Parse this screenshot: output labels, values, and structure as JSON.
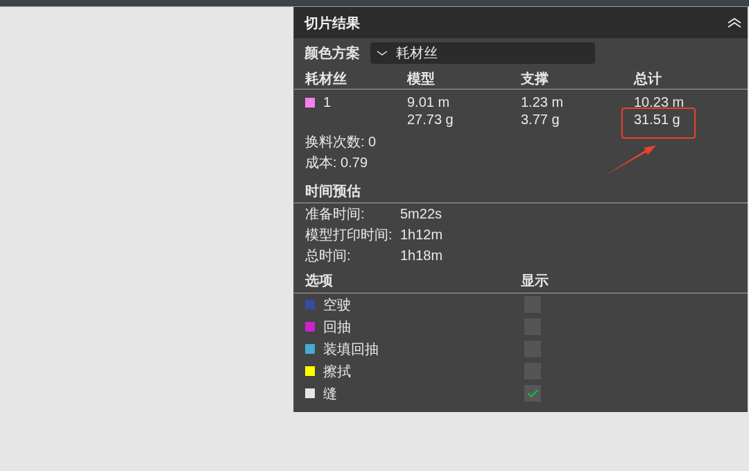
{
  "panel": {
    "title": "切片结果"
  },
  "color_scheme": {
    "label": "颜色方案",
    "value": "耗材丝"
  },
  "filament_table": {
    "columns": [
      "耗材丝",
      "模型",
      "支撑",
      "总计"
    ],
    "rows": [
      {
        "color": "#f77ff2",
        "filament": "1",
        "model": [
          "9.01 m",
          "27.73 g"
        ],
        "support": [
          "1.23 m",
          "3.77 g"
        ],
        "total": [
          "10.23 m",
          "31.51 g"
        ]
      }
    ]
  },
  "summary": [
    "换料次数: 0",
    "成本: 0.79"
  ],
  "time_estimate": {
    "title": "时间预估",
    "items": [
      {
        "label": "准备时间:",
        "value": "5m22s"
      },
      {
        "label": "模型打印时间:",
        "value": "1h12m"
      },
      {
        "label": "总时间:",
        "value": "1h18m"
      }
    ]
  },
  "options": {
    "columns": [
      "选项",
      "显示"
    ],
    "items": [
      {
        "label": "空驶",
        "color": "#3a4a9c",
        "checked": false
      },
      {
        "label": "回抽",
        "color": "#cc22cc",
        "checked": false
      },
      {
        "label": "装填回抽",
        "color": "#47acd0",
        "checked": false
      },
      {
        "label": "擦拭",
        "color": "#ffff00",
        "checked": false
      },
      {
        "label": "缝",
        "color": "#e6e6e6",
        "checked": true
      }
    ]
  }
}
